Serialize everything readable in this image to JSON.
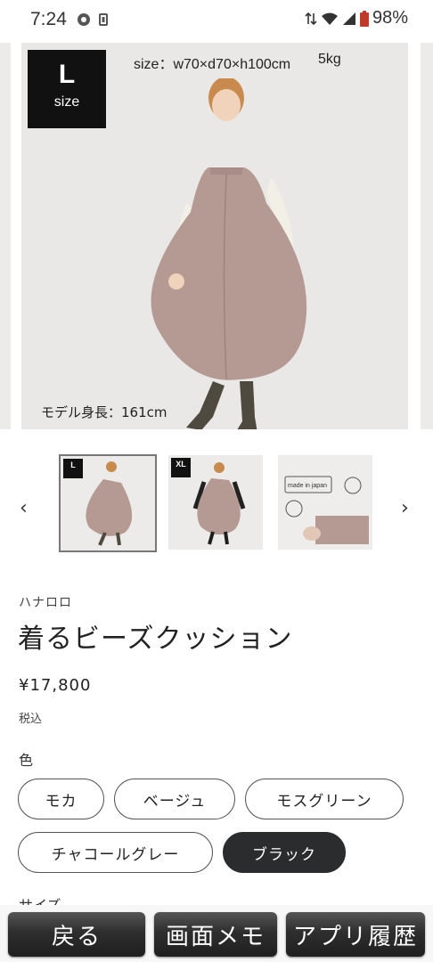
{
  "status_bar": {
    "time": "7:24",
    "battery": "98%"
  },
  "hero": {
    "size_badge_big": "L",
    "size_badge_small": "size",
    "size_spec": "size：w70×d70×h100cm",
    "weight": "5kg",
    "model_height": "モデル身長：161cm"
  },
  "thumbnails": {
    "prev_arrow": "‹",
    "next_arrow": "›",
    "items": [
      {
        "badge": "L"
      },
      {
        "badge": "XL"
      },
      {
        "label": "made in japan"
      }
    ]
  },
  "product": {
    "brand": "ハナロロ",
    "title": "着るビーズクッション",
    "price": "¥17,800",
    "tax_note": "税込",
    "color_label": "色",
    "colors": [
      "モカ",
      "ベージュ",
      "モスグリーン",
      "チャコールグレー",
      "ブラック"
    ],
    "selected_color": "ブラック",
    "size_label": "サイズ"
  },
  "bottom_bar": {
    "back": "戻る",
    "memo": "画面メモ",
    "history": "アプリ履歴"
  },
  "colors": {
    "cushion": "#b59a93",
    "selected_chip": "#2a2c2d",
    "background": "#e9e8e6"
  }
}
